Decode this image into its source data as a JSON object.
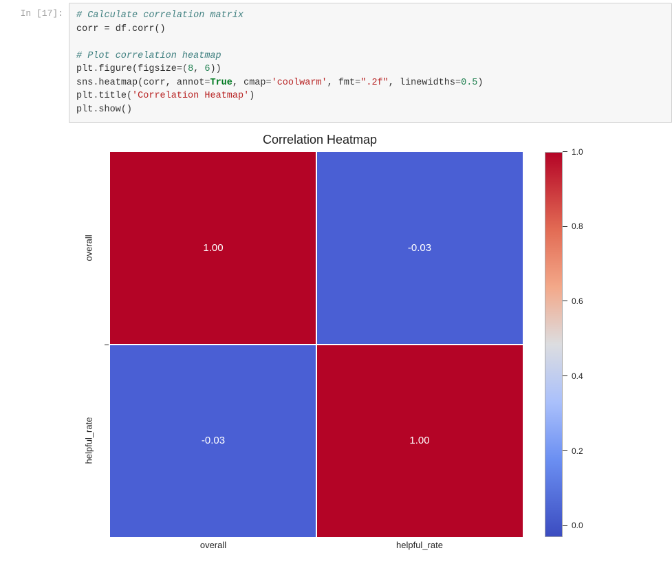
{
  "cell": {
    "prompt": "In [17]:",
    "code": {
      "l1_comment": "# Calculate correlation matrix",
      "l2_a": "corr ",
      "l2_b": "=",
      "l2_c": " df",
      "l2_d": ".",
      "l2_e": "corr",
      "l2_f": "()",
      "l4_comment": "# Plot correlation heatmap",
      "l5_a": "plt",
      "l5_b": ".",
      "l5_c": "figure",
      "l5_d": "(",
      "l5_e": "figsize",
      "l5_f": "=(",
      "l5_g": "8",
      "l5_h": ", ",
      "l5_i": "6",
      "l5_j": "))",
      "l6_a": "sns",
      "l6_b": ".",
      "l6_c": "heatmap",
      "l6_d": "(",
      "l6_e": "corr, annot",
      "l6_f": "=",
      "l6_g": "True",
      "l6_h": ", cmap",
      "l6_i": "=",
      "l6_j": "'coolwarm'",
      "l6_k": ", fmt",
      "l6_l": "=",
      "l6_m": "\".2f\"",
      "l6_n": ", linewidths",
      "l6_o": "=",
      "l6_p": "0.5",
      "l6_q": ")",
      "l7_a": "plt",
      "l7_b": ".",
      "l7_c": "title",
      "l7_d": "(",
      "l7_e": "'Correlation Heatmap'",
      "l7_f": ")",
      "l8_a": "plt",
      "l8_b": ".",
      "l8_c": "show",
      "l8_d": "()"
    }
  },
  "chart_data": {
    "type": "heatmap",
    "title": "Correlation Heatmap",
    "x_labels": [
      "overall",
      "helpful_rate"
    ],
    "y_labels": [
      "overall",
      "helpful_rate"
    ],
    "matrix": [
      [
        1.0,
        -0.03
      ],
      [
        -0.03,
        1.0
      ]
    ],
    "cell_text": [
      [
        "1.00",
        "-0.03"
      ],
      [
        "-0.03",
        "1.00"
      ]
    ],
    "cell_colors": [
      [
        "#b40426",
        "#4a5fd4"
      ],
      [
        "#4a5fd4",
        "#b40426"
      ]
    ],
    "colorbar": {
      "vmin": -0.03,
      "vmax": 1.0,
      "ticks": [
        {
          "label": "1.0",
          "pos_pct": 0
        },
        {
          "label": "0.8",
          "pos_pct": 19.4
        },
        {
          "label": "0.6",
          "pos_pct": 38.8
        },
        {
          "label": "0.4",
          "pos_pct": 58.3
        },
        {
          "label": "0.2",
          "pos_pct": 77.7
        },
        {
          "label": "0.0",
          "pos_pct": 97.1
        }
      ]
    }
  }
}
